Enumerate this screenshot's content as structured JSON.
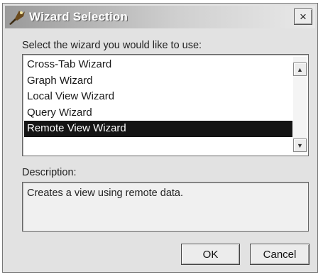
{
  "window": {
    "title": "Wizard Selection",
    "close_glyph": "×"
  },
  "prompt": "Select the wizard you would like to use:",
  "wizards": {
    "items": [
      "Cross-Tab Wizard",
      "Graph Wizard",
      "Local View Wizard",
      "Query Wizard",
      "Remote View Wizard"
    ],
    "selected": "Remote View Wizard"
  },
  "description": {
    "label": "Description:",
    "text": "Creates a view using remote data."
  },
  "buttons": {
    "ok": "OK",
    "cancel": "Cancel"
  },
  "icons": {
    "app": "wizard-icon",
    "scroll_up": "arrow-up-icon",
    "scroll_down": "arrow-down-icon"
  }
}
